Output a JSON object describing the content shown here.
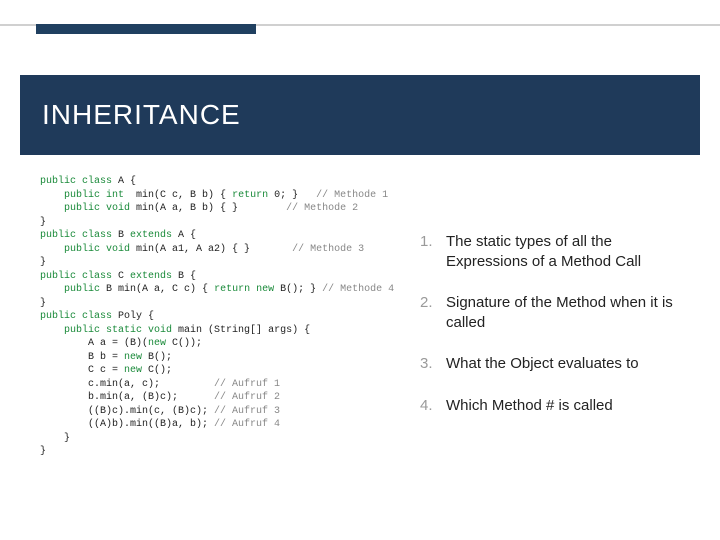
{
  "title": "INHERITANCE",
  "code": {
    "lines": [
      {
        "indent": 0,
        "segments": [
          {
            "t": "public class",
            "c": "kw"
          },
          {
            "t": " A {"
          }
        ]
      },
      {
        "indent": 1,
        "segments": [
          {
            "t": "public int",
            "c": "kw"
          },
          {
            "t": "  min(C c, B b) { "
          },
          {
            "t": "return",
            "c": "kw"
          },
          {
            "t": " 0; }   "
          },
          {
            "t": "// Methode 1",
            "c": "cm"
          }
        ]
      },
      {
        "indent": 1,
        "segments": [
          {
            "t": "public void",
            "c": "kw"
          },
          {
            "t": " min(A a, B b) { }        "
          },
          {
            "t": "// Methode 2",
            "c": "cm"
          }
        ]
      },
      {
        "indent": 0,
        "segments": [
          {
            "t": "}"
          }
        ]
      },
      {
        "indent": 0,
        "segments": [
          {
            "t": "public class",
            "c": "kw"
          },
          {
            "t": " B "
          },
          {
            "t": "extends",
            "c": "kw"
          },
          {
            "t": " A {"
          }
        ]
      },
      {
        "indent": 1,
        "segments": [
          {
            "t": "public void",
            "c": "kw"
          },
          {
            "t": " min(A a1, A a2) { }       "
          },
          {
            "t": "// Methode 3",
            "c": "cm"
          }
        ]
      },
      {
        "indent": 0,
        "segments": [
          {
            "t": "}"
          }
        ]
      },
      {
        "indent": 0,
        "segments": [
          {
            "t": "public class",
            "c": "kw"
          },
          {
            "t": " C "
          },
          {
            "t": "extends",
            "c": "kw"
          },
          {
            "t": " B {"
          }
        ]
      },
      {
        "indent": 1,
        "segments": [
          {
            "t": "public",
            "c": "kw"
          },
          {
            "t": " B min(A a, C c) { "
          },
          {
            "t": "return new",
            "c": "kw"
          },
          {
            "t": " B(); } "
          },
          {
            "t": "// Methode 4",
            "c": "cm"
          }
        ]
      },
      {
        "indent": 0,
        "segments": [
          {
            "t": "}"
          }
        ]
      },
      {
        "indent": 0,
        "segments": [
          {
            "t": "public class",
            "c": "kw"
          },
          {
            "t": " Poly {"
          }
        ]
      },
      {
        "indent": 1,
        "segments": [
          {
            "t": "public static void",
            "c": "kw"
          },
          {
            "t": " main (String[] args) {"
          }
        ]
      },
      {
        "indent": 2,
        "segments": [
          {
            "t": "A a = (B)("
          },
          {
            "t": "new",
            "c": "kw"
          },
          {
            "t": " C());"
          }
        ]
      },
      {
        "indent": 2,
        "segments": [
          {
            "t": "B b = "
          },
          {
            "t": "new",
            "c": "kw"
          },
          {
            "t": " B();"
          }
        ]
      },
      {
        "indent": 2,
        "segments": [
          {
            "t": "C c = "
          },
          {
            "t": "new",
            "c": "kw"
          },
          {
            "t": " C();"
          }
        ]
      },
      {
        "indent": 2,
        "segments": [
          {
            "t": "c.min(a, c);         "
          },
          {
            "t": "// Aufruf 1",
            "c": "cm"
          }
        ]
      },
      {
        "indent": 2,
        "segments": [
          {
            "t": "b.min(a, (B)c);      "
          },
          {
            "t": "// Aufruf 2",
            "c": "cm"
          }
        ]
      },
      {
        "indent": 2,
        "segments": [
          {
            "t": "((B)c).min(c, (B)c); "
          },
          {
            "t": "// Aufruf 3",
            "c": "cm"
          }
        ]
      },
      {
        "indent": 2,
        "segments": [
          {
            "t": "((A)b).min((B)a, b); "
          },
          {
            "t": "// Aufruf 4",
            "c": "cm"
          }
        ]
      },
      {
        "indent": 1,
        "segments": [
          {
            "t": "}"
          }
        ]
      },
      {
        "indent": 0,
        "segments": [
          {
            "t": "}"
          }
        ]
      }
    ]
  },
  "list": {
    "items": [
      "The static types of all the Expressions of a Method Call",
      "Signature of the Method when it is called",
      "What the Object evaluates to",
      "Which Method # is called"
    ]
  }
}
